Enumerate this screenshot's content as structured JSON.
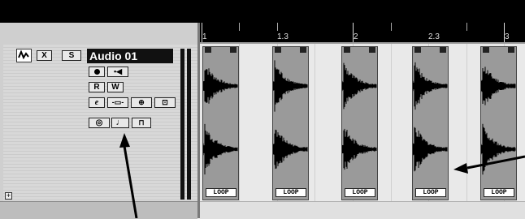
{
  "ruler": {
    "labels": [
      "1",
      "1.3",
      "2",
      "2.3",
      "3"
    ]
  },
  "track": {
    "name": "Audio 01",
    "buttons": {
      "mute": "X",
      "solo": "S",
      "read": "R",
      "write": "W",
      "edit": "e"
    }
  },
  "events": [
    {
      "loop_label": "LOOP"
    },
    {
      "loop_label": "LOOP"
    },
    {
      "loop_label": "LOOP"
    },
    {
      "loop_label": "LOOP"
    },
    {
      "loop_label": "LOOP"
    }
  ],
  "icons": {
    "track_type": "audio-track-icon",
    "record": "record-enable-icon",
    "monitor": "monitor-speaker-icon",
    "edit": "edit-channel-icon",
    "insert": "insert-icon",
    "eq": "eq-icon",
    "send": "send-icon",
    "stereo": "stereo-link-icon",
    "music_note": "musical-timebase-icon",
    "lock": "lock-icon"
  },
  "colors": {
    "ruler_background": "#000000",
    "event_fill": "#9a9a9a",
    "track_name_bg": "#111111"
  }
}
